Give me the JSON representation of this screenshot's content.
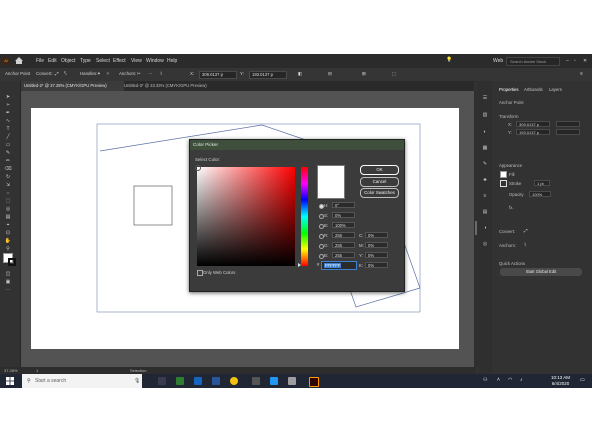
{
  "app": {
    "menu": [
      "File",
      "Edit",
      "Object",
      "Type",
      "Select",
      "Effect",
      "View",
      "Window",
      "Help"
    ],
    "workspace": "Web",
    "search_placeholder": "Search Adobe Stock"
  },
  "controlbar": {
    "selection_label": "Anchor Point",
    "convert_label": "Convert:",
    "handles_label": "Handles:",
    "anchors_label": "Anchors:",
    "x_value": "309.0137 p",
    "y_value": "193.0137 p"
  },
  "tabs": [
    {
      "label": "Untitled-2* @ 37.28% (CMYK/GPU Preview)",
      "active": true
    },
    {
      "label": "Untitled-3* @ 33.33% (CMYK/GPU Preview)",
      "active": false
    }
  ],
  "status": {
    "zoom": "37.28%",
    "page": "1",
    "mode": "Selection"
  },
  "properties": {
    "tabs": [
      "Properties",
      "Artboards",
      "Layers"
    ],
    "anchor_point": "Anchor Point",
    "transform": "Transform",
    "x": "309.0137 p",
    "y": "193.0137 p",
    "appearance": "Appearance",
    "fill": "Fill",
    "stroke": "Stroke",
    "stroke_weight": "1 pt",
    "opacity": "Opacity",
    "opacity_value": "100%",
    "fx": "fx.",
    "convert": "Convert:",
    "anchors": "Anchors:",
    "quick_actions": "Quick Actions",
    "start_global_edit": "Start Global Edit"
  },
  "color_picker": {
    "title": "Color Picker",
    "select_color": "Select Color:",
    "ok": "OK",
    "cancel": "Cancel",
    "swatches": "Color Swatches",
    "h": "0°",
    "s": "0%",
    "b": "100%",
    "r": "255",
    "g": "255",
    "bl": "255",
    "c": "0%",
    "m": "0%",
    "yv": "0%",
    "k": "0%",
    "hex": "FFFFFF",
    "only_web": "Only Web Colors",
    "labels": {
      "h": "H:",
      "s": "S:",
      "b": "B:",
      "r": "R:",
      "g": "G:",
      "bl": "B:",
      "c": "C:",
      "m": "M:",
      "y": "Y:",
      "k": "K:",
      "hash": "#"
    }
  },
  "taskbar": {
    "search": "Start a search",
    "time": "10:13 AM",
    "date": "6/4/2020"
  },
  "colors": {
    "ui_bg": "#323232",
    "dialog_title": "#3e4f3c",
    "accent": "#3d7fd0"
  }
}
